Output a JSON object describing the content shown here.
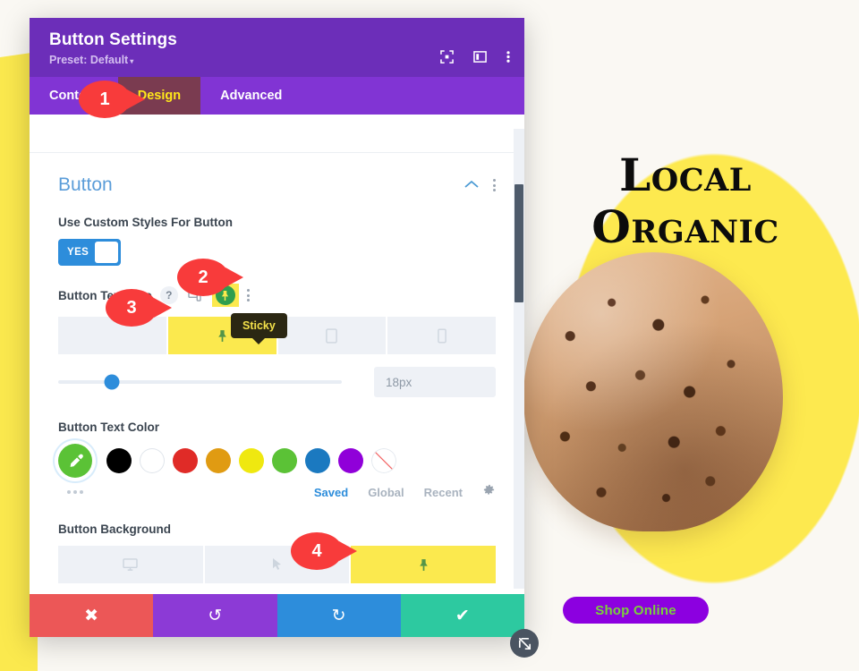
{
  "page": {
    "brand_line1": "Local",
    "brand_line2": "Organic",
    "shop_button_label": "Shop Online",
    "shop_button_bg": "#8c00e0",
    "shop_button_text_color": "#7ad13a",
    "accent_yellow": "#fbe94e",
    "background": "#faf8f3"
  },
  "modal": {
    "title": "Button Settings",
    "preset_label": "Preset: Default",
    "preset_caret": "▾",
    "header_icons": [
      {
        "name": "focus-icon"
      },
      {
        "name": "split-view-icon"
      },
      {
        "name": "more-options-icon"
      }
    ],
    "tabs": [
      {
        "label": "Content",
        "active": false
      },
      {
        "label": "Design",
        "active": true
      },
      {
        "label": "Advanced",
        "active": false
      }
    ],
    "active_tab": "Design",
    "active_tab_bg": "#7a3b50",
    "active_tab_color": "#ffe81a",
    "header_bg": "#6c2eb9",
    "tabbar_bg": "#8134d4"
  },
  "section": {
    "title": "Button",
    "collapse_icon": "chevron-up-icon",
    "menu_icon": "more-options-icon"
  },
  "fields": {
    "use_custom_styles": {
      "label": "Use Custom Styles For Button",
      "toggle_value": "YES",
      "toggle_on": true,
      "toggle_color": "#2d8ddb"
    },
    "button_text_size": {
      "label": "Button Text Size",
      "help_icon": "question-mark-icon",
      "responsive_icon": "responsive-icon",
      "sticky_icon": "pin-icon",
      "options_icon": "more-options-icon",
      "device_tabs": [
        {
          "name": "desktop",
          "icon": "desktop-icon",
          "highlighted": false,
          "visible": false
        },
        {
          "name": "sticky",
          "icon": "pin-icon",
          "highlighted": true,
          "visible": true
        },
        {
          "name": "tablet",
          "icon": "tablet-icon",
          "highlighted": false,
          "visible": true
        },
        {
          "name": "phone",
          "icon": "phone-icon",
          "highlighted": false,
          "visible": true
        }
      ],
      "tooltip": "Sticky",
      "tooltip_bg": "#2b2713",
      "tooltip_color": "#f3e04a",
      "slider_percent": 19,
      "value": "18px"
    },
    "button_text_color": {
      "label": "Button Text Color",
      "picker_icon": "eyedropper-icon",
      "picker_color": "#5bc236",
      "swatches": [
        {
          "name": "black",
          "color": "#000000"
        },
        {
          "name": "white",
          "color": "#ffffff"
        },
        {
          "name": "red",
          "color": "#e02b27"
        },
        {
          "name": "orange",
          "color": "#e09b12"
        },
        {
          "name": "yellow",
          "color": "#efe810"
        },
        {
          "name": "green",
          "color": "#5bc236"
        },
        {
          "name": "blue",
          "color": "#1b79c0"
        },
        {
          "name": "purple",
          "color": "#9000d9"
        },
        {
          "name": "none",
          "color": "transparent"
        }
      ],
      "more_icon": "ellipsis-icon",
      "links": [
        {
          "label": "Saved",
          "active": true
        },
        {
          "label": "Global",
          "active": false
        },
        {
          "label": "Recent",
          "active": false
        }
      ],
      "settings_icon": "gear-icon"
    },
    "button_background": {
      "label": "Button Background",
      "device_tabs": [
        {
          "name": "desktop",
          "icon": "desktop-icon",
          "highlighted": false
        },
        {
          "name": "hover",
          "icon": "cursor-icon",
          "highlighted": false
        },
        {
          "name": "sticky",
          "icon": "pin-icon",
          "highlighted": true
        }
      ],
      "type_tabs": [
        {
          "name": "color",
          "icon": "paintbrush-icon",
          "selected": true
        },
        {
          "name": "gradient",
          "icon": "gradient-icon",
          "selected": false
        },
        {
          "name": "image",
          "icon": "image-icon",
          "selected": false
        }
      ]
    }
  },
  "footer": {
    "buttons": [
      {
        "name": "cancel",
        "icon": "close-icon",
        "glyph": "✖",
        "color": "#ec5757"
      },
      {
        "name": "undo",
        "icon": "undo-icon",
        "glyph": "↺",
        "color": "#8c3ad6"
      },
      {
        "name": "redo",
        "icon": "redo-icon",
        "glyph": "↻",
        "color": "#2d8ddb"
      },
      {
        "name": "save",
        "icon": "checkmark-icon",
        "glyph": "✔",
        "color": "#2dc9a0"
      }
    ]
  },
  "resize_handle": {
    "icon": "resize-diagonal-icon"
  },
  "markers": [
    {
      "number": "1",
      "target": "design-tab"
    },
    {
      "number": "2",
      "target": "sticky-toggle-icon"
    },
    {
      "number": "3",
      "target": "sticky-device-tab"
    },
    {
      "number": "4",
      "target": "background-sticky-tab"
    }
  ],
  "scrollbar": {
    "name": "vertical-scrollbar"
  }
}
